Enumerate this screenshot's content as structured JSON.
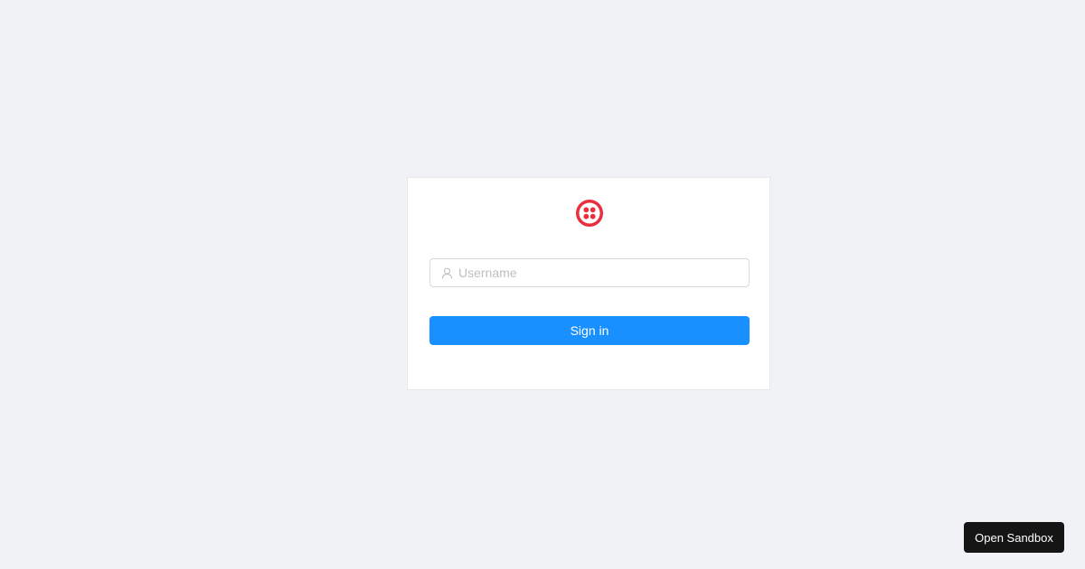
{
  "login": {
    "logo_icon": "twilio-logo-icon",
    "brand_color": "#e8303f",
    "username_placeholder": "Username",
    "username_value": "",
    "user_icon": "user-icon",
    "signin_label": "Sign in",
    "signin_color": "#1890ff"
  },
  "sandbox": {
    "label": "Open Sandbox"
  }
}
